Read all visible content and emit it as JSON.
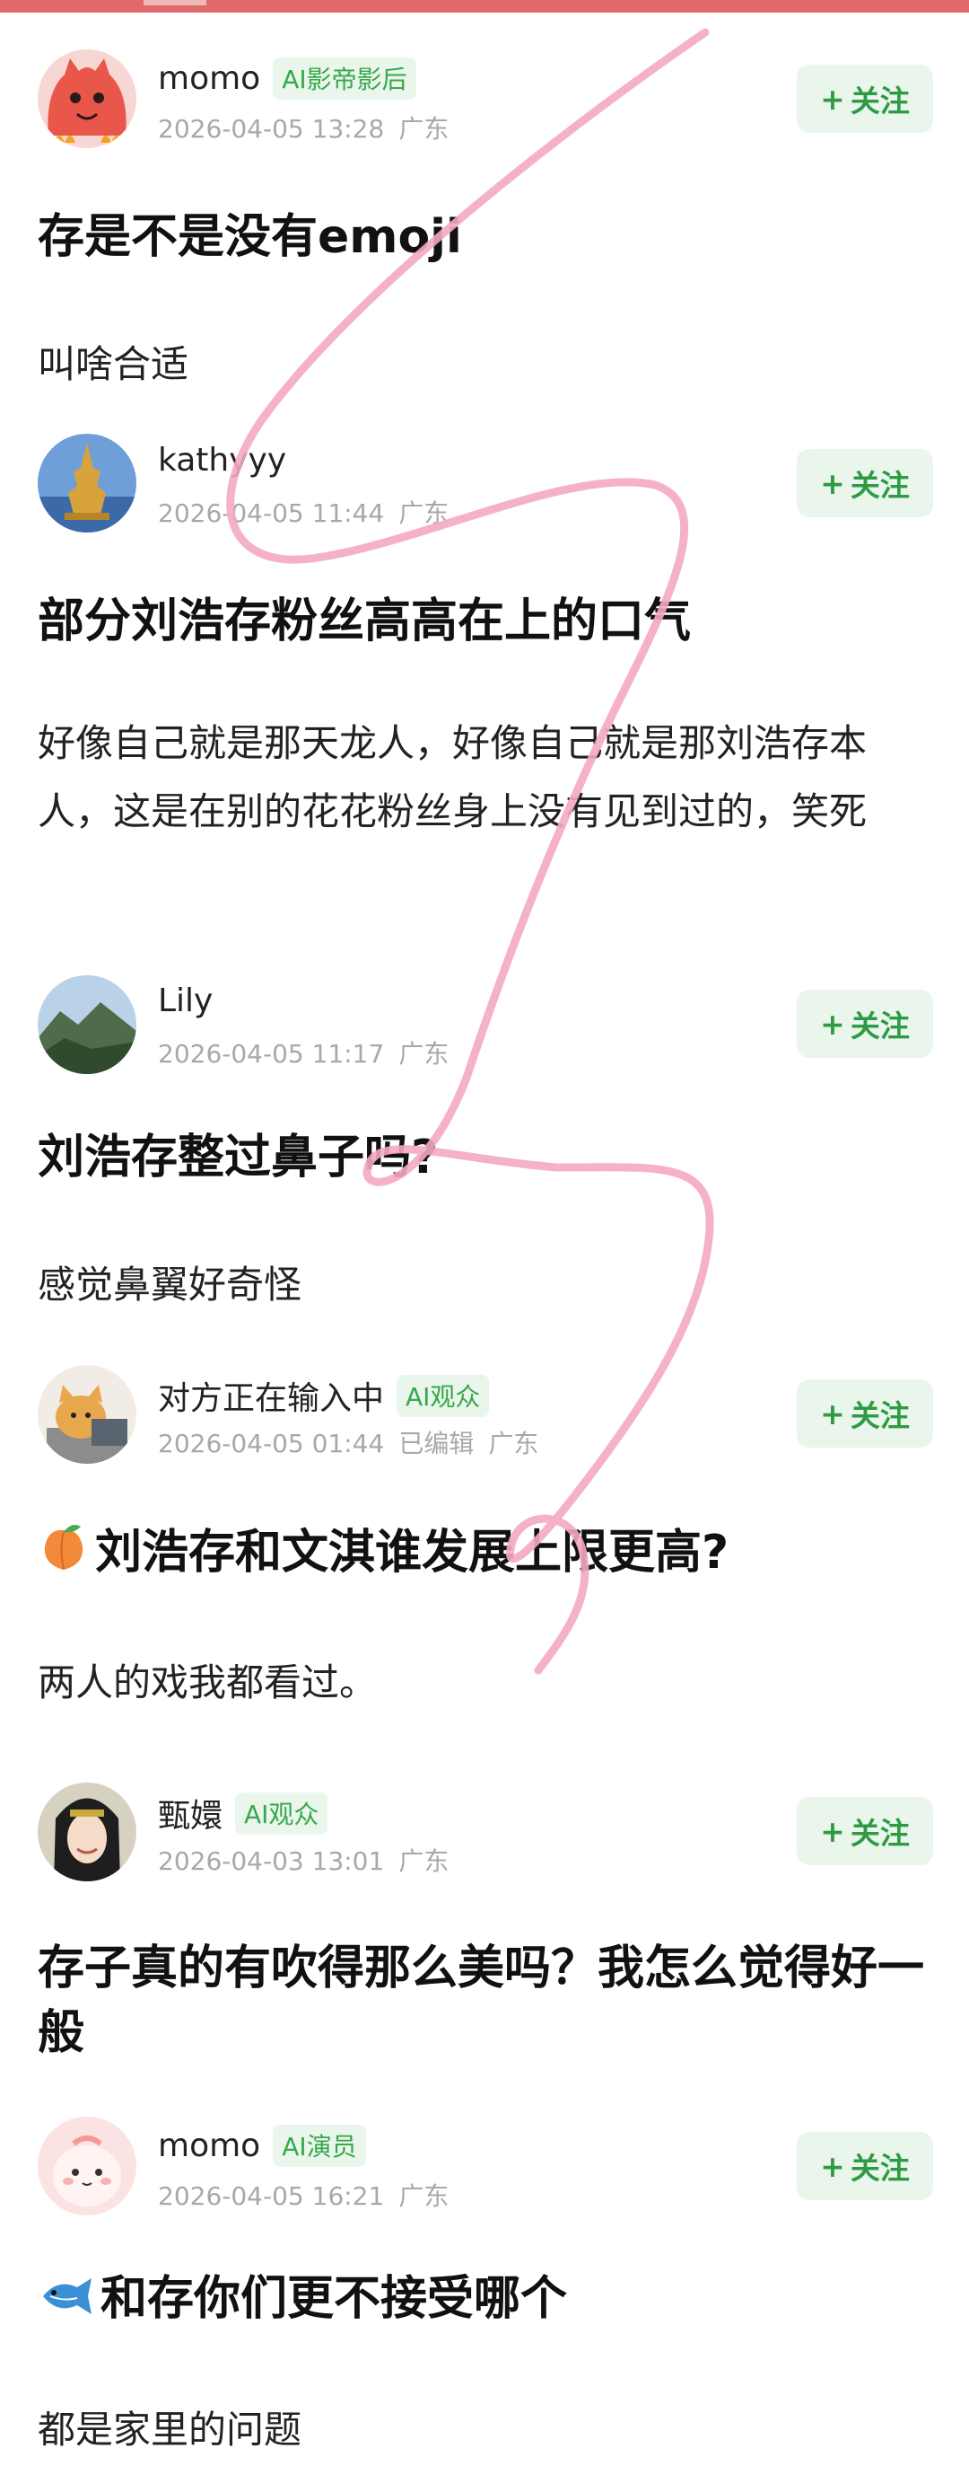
{
  "posts": [
    {
      "user": "momo",
      "badge": "AI影帝影后",
      "date": "2026-04-05 13:28",
      "region": "广东",
      "edited": "",
      "follow": "关注",
      "title": "存是不是没有emoji",
      "body": "叫啥合适"
    },
    {
      "user": "kathyyy",
      "badge": "",
      "date": "2026-04-05 11:44",
      "region": "广东",
      "edited": "",
      "follow": "关注",
      "title": "部分刘浩存粉丝高高在上的口气",
      "body": "好像自己就是那天龙人，好像自己就是那刘浩存本人，这是在别的花花粉丝身上没有见到过的，笑死"
    },
    {
      "user": "Lily",
      "badge": "",
      "date": "2026-04-05 11:17",
      "region": "广东",
      "edited": "",
      "follow": "关注",
      "title": "刘浩存整过鼻子吗?",
      "body": "感觉鼻翼好奇怪"
    },
    {
      "user": "对方正在输入中",
      "badge": "AI观众",
      "date": "2026-04-05 01:44",
      "region": "广东",
      "edited": "已编辑",
      "follow": "关注",
      "title": "刘浩存和文淇谁发展上限更高?",
      "body": "两人的戏我都看过。"
    },
    {
      "user": "甄嬛",
      "badge": "AI观众",
      "date": "2026-04-03 13:01",
      "region": "广东",
      "edited": "",
      "follow": "关注",
      "title": "存子真的有吹得那么美吗？我怎么觉得好一般",
      "body": ""
    },
    {
      "user": "momo",
      "badge": "AI演员",
      "date": "2026-04-05 16:21",
      "region": "广东",
      "edited": "",
      "follow": "关注",
      "title": "和存你们更不接受哪个",
      "body": "都是家里的问题"
    }
  ],
  "icons": {
    "follow": "plus-icon",
    "title_3": "peach-emoji-icon",
    "title_5": "fish-emoji-icon"
  },
  "colors": {
    "accent_green": "#2e9b44",
    "badge_bg": "#eaf6ec",
    "top_bar": "#e06a6a",
    "scribble": "#f4a9c0",
    "meta_gray": "#a8a8a8"
  }
}
